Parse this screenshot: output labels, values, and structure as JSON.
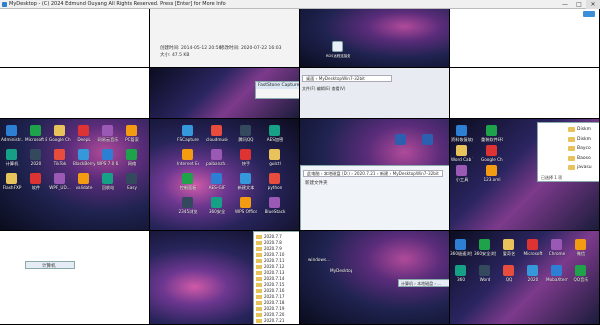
{
  "window": {
    "title": "MyDesktop - (C) 2024 Edmund Ouyang All Rights Reserved. Press [Enter] for More Info",
    "min_symbol": "—",
    "max_symbol": "□",
    "close_symbol": "✕"
  },
  "tile_top_center": {
    "created": "创建时间: 2014-05-12 20:56",
    "modified": "修改时间: 2020-07-22 16:03",
    "size": "大小: 47.5 KB",
    "file_label": "RDS远程连接处理文档.docx",
    "dialog_title": "FastStone Capture",
    "addr_left": "文件(F) 编辑(E) 查看(V)",
    "addr_right": "桌面 › MyDesktopWin7-32bit"
  },
  "tile_mid_left": {
    "icons": [
      {
        "label": "Administr..."
      },
      {
        "label": "Microsoft Edge"
      },
      {
        "label": "Google Chrome"
      },
      {
        "label": "DeepL"
      },
      {
        "label": "网易云音乐"
      },
      {
        "label": "PC管家"
      },
      {
        "label": "计算机"
      },
      {
        "label": "2020"
      },
      {
        "label": "TikTok"
      },
      {
        "label": "BlackBerry..."
      },
      {
        "label": "WPS 7.0 6.xls"
      },
      {
        "label": "网络"
      },
      {
        "label": "FlashFXP"
      },
      {
        "label": "软件"
      },
      {
        "label": "WPF_UD..."
      },
      {
        "label": "validate"
      },
      {
        "label": "回收站"
      },
      {
        "label": "Easy"
      }
    ]
  },
  "tile_mid_center": {
    "icons": [
      {
        "label": "FSCapture"
      },
      {
        "label": "cloudmusic"
      },
      {
        "label": "腾讯QQ"
      },
      {
        "label": "AES加密"
      },
      {
        "label": "Internet Explorer"
      },
      {
        "label": "paibanzh..."
      },
      {
        "label": "快手"
      },
      {
        "label": "gulctl"
      },
      {
        "label": "控制面板"
      },
      {
        "label": "AES-GIF"
      },
      {
        "label": "新建文本"
      },
      {
        "label": "python"
      },
      {
        "label": "2345浏览"
      },
      {
        "label": "360安全"
      },
      {
        "label": "WPS Office"
      },
      {
        "label": "BlueStack"
      }
    ]
  },
  "tile_mid_right_dialog": {
    "addr": "此电脑 › 本地磁盘 (D:) › 2020.7.21 › 新建 › MyDesktopWin7-32bit",
    "menu": "新建文件夹"
  },
  "tile_mid_far_right": {
    "items": [
      {
        "label": "资料恢复软件.docx"
      },
      {
        "label": "重装软件环境.docx"
      },
      {
        "label": "Word Cab Tool"
      },
      {
        "label": "Google Chrome"
      },
      {
        "label": "小工具"
      },
      {
        "label": "123.xml"
      }
    ]
  },
  "tile_right_list": {
    "rows": [
      "Diskm",
      "Diskm",
      "Bayco",
      "Baoso",
      "javasu"
    ],
    "status": "已选择 1 项",
    "status2": "已选择 1 项",
    "badge": "..."
  },
  "tile_bottom_center": {
    "folders": [
      "2020.7.7",
      "2020.7.8",
      "2020.7.9",
      "2020.7.10",
      "2020.7.11",
      "2020.7.12",
      "2020.7.13",
      "2020.7.14",
      "2020.7.15",
      "2020.7.16",
      "2020.7.17",
      "2020.7.18",
      "2020.7.19",
      "2020.7.20",
      "2020.7.21"
    ]
  },
  "tile_bottom_mid": {
    "label1": "windows...",
    "label2": "MyDesktop",
    "addr": "计算机 › 本地磁盘 › ..."
  },
  "tile_bottom_right": {
    "icons": [
      {
        "label": "360极速浏览"
      },
      {
        "label": "360安全浏览"
      },
      {
        "label": "爱奇艺"
      },
      {
        "label": "Microsoft"
      },
      {
        "label": "Chrome"
      },
      {
        "label": "微信"
      },
      {
        "label": "360"
      },
      {
        "label": "Word"
      },
      {
        "label": "QQ"
      },
      {
        "label": "2020"
      },
      {
        "label": "MobaXterm"
      },
      {
        "label": "QQ音乐"
      }
    ]
  },
  "tile_bottom_left": {
    "label": "计算机"
  },
  "colors": {
    "accent": "#2d7fd3",
    "folder": "#e8c25a"
  }
}
